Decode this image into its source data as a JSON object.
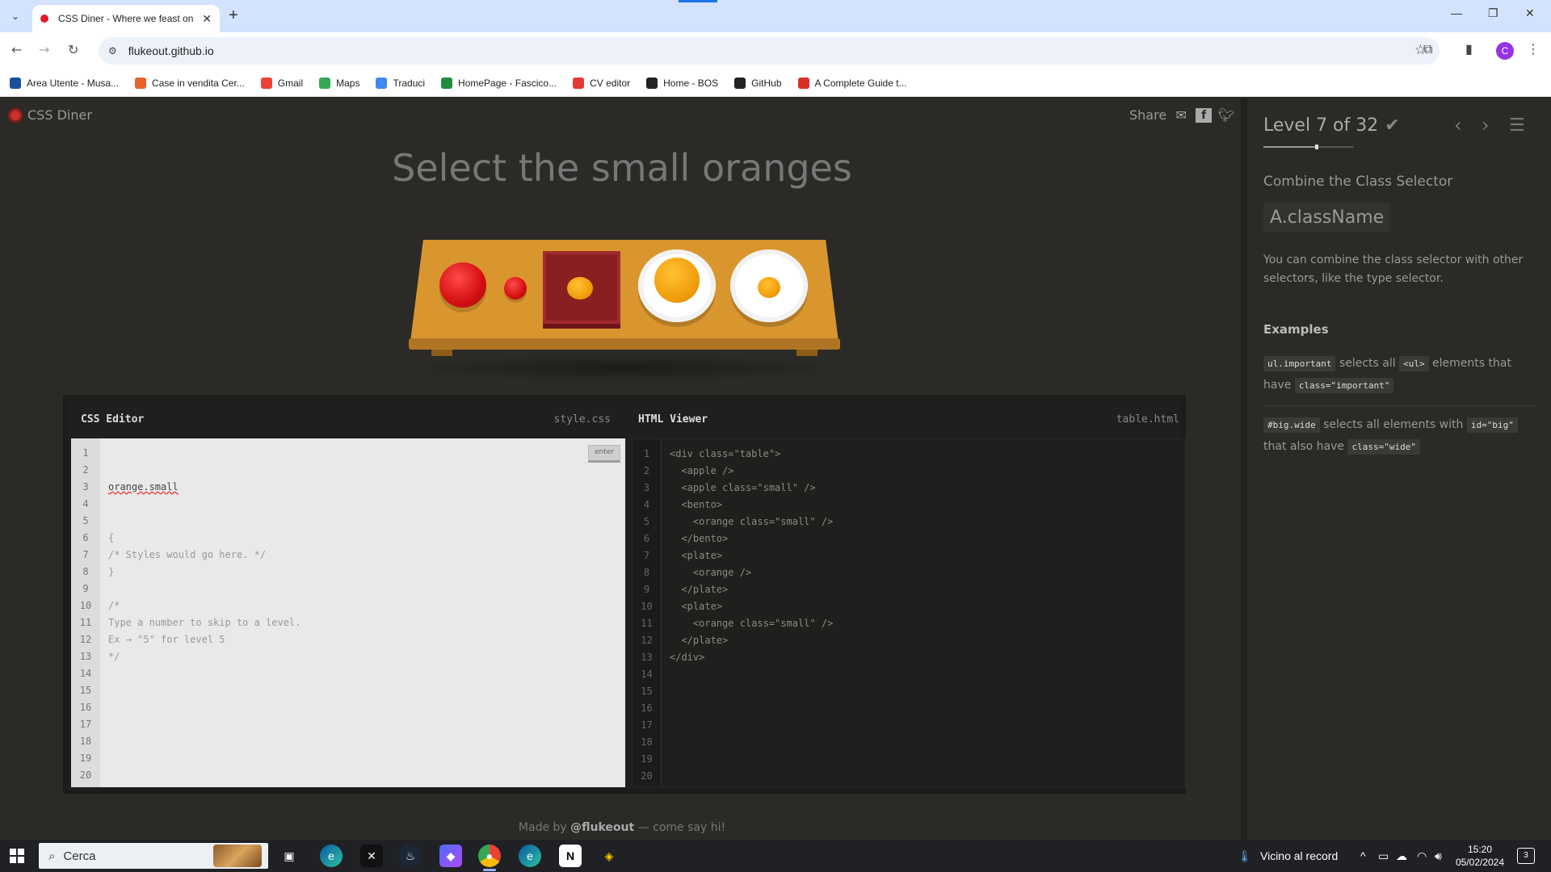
{
  "browser": {
    "tab_title": "CSS Diner - Where we feast on",
    "url": "flukeout.github.io",
    "profile_initial": "C",
    "bookmarks": [
      {
        "label": "Area Utente - Musa...",
        "icon": "musa-icon",
        "color": "#1a4fa0"
      },
      {
        "label": "Case in vendita Cer...",
        "icon": "house-icon",
        "color": "#e7632e"
      },
      {
        "label": "Gmail",
        "icon": "gmail-icon",
        "color": "#ea4335"
      },
      {
        "label": "Maps",
        "icon": "maps-icon",
        "color": "#34a853"
      },
      {
        "label": "Traduci",
        "icon": "translate-icon",
        "color": "#4285f4"
      },
      {
        "label": "HomePage - Fascico...",
        "icon": "fascicolo-icon",
        "color": "#1e8e3e"
      },
      {
        "label": "CV editor",
        "icon": "cv-icon",
        "color": "#e53935"
      },
      {
        "label": "Home - BOS",
        "icon": "bos-icon",
        "color": "#222222"
      },
      {
        "label": "GitHub",
        "icon": "github-icon",
        "color": "#222222"
      },
      {
        "label": "A Complete Guide t...",
        "icon": "asterisk-icon",
        "color": "#d93025"
      }
    ]
  },
  "app": {
    "logo_text": "CSS Diner",
    "share_label": "Share",
    "instruction": "Select the small oranges",
    "made_by_prefix": "Made by",
    "made_by_handle": "@flukeout",
    "made_by_suffix": "— come say hi!"
  },
  "css_editor": {
    "title": "CSS Editor",
    "filename": "style.css",
    "enter_label": "enter",
    "input_value": "orange.small",
    "lines": [
      "{",
      "/* Styles would go here. */",
      "}",
      "",
      "/*",
      "Type a number to skip to a level.",
      "Ex → \"5\" for level 5",
      "*/"
    ],
    "line_count": 20
  },
  "html_viewer": {
    "title": "HTML Viewer",
    "filename": "table.html",
    "lines": [
      "<div class=\"table\">",
      "  <apple />",
      "  <apple class=\"small\" />",
      "  <bento>",
      "    <orange class=\"small\" />",
      "  </bento>",
      "  <plate>",
      "    <orange />",
      "  </plate>",
      "  <plate>",
      "    <orange class=\"small\" />",
      "  </plate>",
      "</div>"
    ],
    "line_count": 20
  },
  "sidebar": {
    "level_text": "Level 7 of 32",
    "level_current": 7,
    "level_total": 32,
    "subtitle": "Combine the Class Selector",
    "selector": "A.className",
    "description": "You can combine the class selector with other selectors, like the type selector.",
    "examples_title": "Examples",
    "example1": {
      "code1": "ul.important",
      "text1": "selects all",
      "code2": "<ul>",
      "text2": "elements that have",
      "code3": "class=\"important\""
    },
    "example2": {
      "code1": "#big.wide",
      "text1": "selects all elements with",
      "code2": "id=\"big\"",
      "text2": "that also have",
      "code3": "class=\"wide\""
    }
  },
  "taskbar": {
    "search_placeholder": "Cerca",
    "weather": "Vicino al record",
    "time": "15:20",
    "date": "05/02/2024",
    "notifications": "3"
  }
}
